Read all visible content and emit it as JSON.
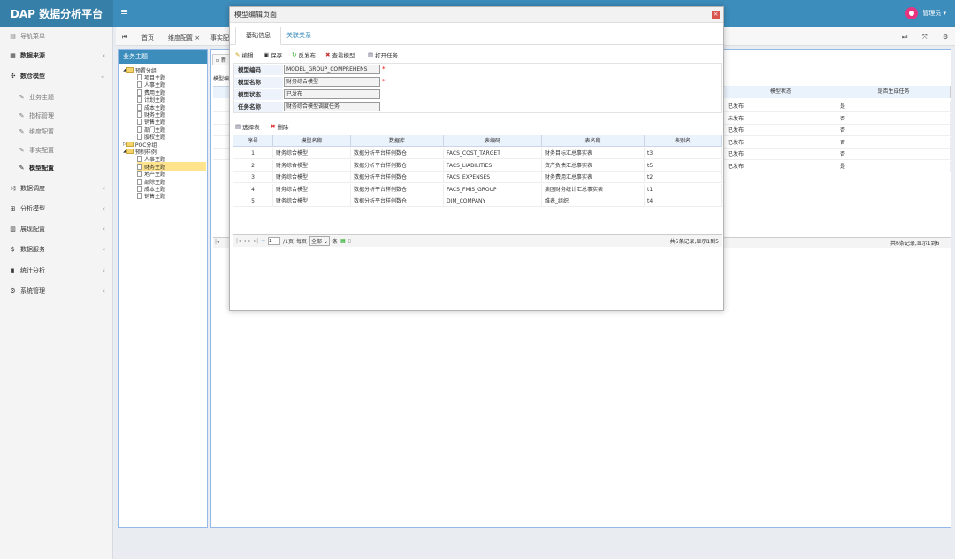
{
  "app": {
    "title": "DAP 数据分析平台",
    "menu_icon": "≡",
    "user": "管理员 ▾"
  },
  "sidebar": {
    "header": "导航菜单",
    "items": [
      {
        "label": "数据来源",
        "icon": "database-icon"
      },
      {
        "label": "数仓模型",
        "icon": "cubes-icon"
      },
      {
        "label": "业务主题",
        "icon": "wrench-icon"
      },
      {
        "label": "指标管理",
        "icon": "wrench-icon"
      },
      {
        "label": "维度配置",
        "icon": "wrench-icon"
      },
      {
        "label": "事实配置",
        "icon": "wrench-icon"
      },
      {
        "label": "模型配置",
        "icon": "wrench-icon"
      },
      {
        "label": "数据调度",
        "icon": "random-icon"
      },
      {
        "label": "分析模型",
        "icon": "sitemap-icon"
      },
      {
        "label": "展现配置",
        "icon": "columns-icon"
      },
      {
        "label": "数据服务",
        "icon": "dollar-icon"
      },
      {
        "label": "统计分析",
        "icon": "chart-icon"
      },
      {
        "label": "系统管理",
        "icon": "gear-icon"
      }
    ]
  },
  "tabs": [
    "首页",
    "维度配置 ×",
    "事实配"
  ],
  "tree": {
    "header": "业务主题",
    "nodes": [
      {
        "label": "预置分组",
        "type": "folder",
        "level": 0
      },
      {
        "label": "项目主题",
        "type": "doc",
        "level": 1
      },
      {
        "label": "人事主题",
        "type": "doc",
        "level": 1
      },
      {
        "label": "费用主题",
        "type": "doc",
        "level": 1
      },
      {
        "label": "计划主题",
        "type": "doc",
        "level": 1
      },
      {
        "label": "成本主题",
        "type": "doc",
        "level": 1
      },
      {
        "label": "财务主题",
        "type": "doc",
        "level": 1
      },
      {
        "label": "销售主题",
        "type": "doc",
        "level": 1
      },
      {
        "label": "部门主题",
        "type": "doc",
        "level": 1
      },
      {
        "label": "股权主题",
        "type": "doc",
        "level": 1
      },
      {
        "label": "POC分组",
        "type": "folder",
        "level": 0
      },
      {
        "label": "预制样例",
        "type": "folder",
        "level": 0
      },
      {
        "label": "人事主题",
        "type": "doc",
        "level": 1
      },
      {
        "label": "财务主题",
        "type": "doc",
        "level": 1,
        "selected": true
      },
      {
        "label": "地产主题",
        "type": "doc",
        "level": 1
      },
      {
        "label": "部除主题",
        "type": "doc",
        "level": 1
      },
      {
        "label": "成本主题",
        "type": "doc",
        "level": 1
      },
      {
        "label": "销售主题",
        "type": "doc",
        "level": 1
      }
    ]
  },
  "bg_grid": {
    "new_btn": "新",
    "partial_label": "模型编",
    "headers": [
      "模型状态",
      "是否生成任务"
    ],
    "rows": [
      [
        "已发布",
        "是"
      ],
      [
        "未发布",
        "否"
      ],
      [
        "已发布",
        "否"
      ],
      [
        "已发布",
        "否"
      ],
      [
        "已发布",
        "否"
      ],
      [
        "已发布",
        "是"
      ]
    ],
    "footer": "共6条记录,显示1到6"
  },
  "dialog": {
    "title": "模型编辑页面",
    "close": "×",
    "tabs": [
      "基础信息",
      "关联关系"
    ],
    "toolbar": [
      "编辑",
      "保存",
      "反发布",
      "查看模型",
      "打开任务"
    ],
    "fields": [
      {
        "label": "模型编码",
        "value": "MODEL_GROUP_COMPREHENS",
        "required": "*"
      },
      {
        "label": "模型名称",
        "value": "财务综合模型",
        "required": "*"
      },
      {
        "label": "模型状态",
        "value": "已发布",
        "required": ""
      },
      {
        "label": "任务名称",
        "value": "财务综合模型调度任务",
        "required": ""
      }
    ],
    "grid_toolbar": [
      "选择表",
      "删除"
    ],
    "headers": [
      "序号",
      "模型名称",
      "数据库",
      "表编码",
      "表名称",
      "表别名"
    ],
    "rows": [
      [
        "1",
        "财务综合模型",
        "数据分析平台样例数仓",
        "FACS_COST_TARGET",
        "财务目标汇总事实表",
        "t3"
      ],
      [
        "2",
        "财务综合模型",
        "数据分析平台样例数仓",
        "FACS_LIABILITIES",
        "资产负债汇总事实表",
        "t5"
      ],
      [
        "3",
        "财务综合模型",
        "数据分析平台样例数仓",
        "FACS_EXPENSES",
        "财务费用汇总事实表",
        "t2"
      ],
      [
        "4",
        "财务综合模型",
        "数据分析平台样例数仓",
        "FACS_FMIS_GROUP",
        "集团财务统计汇总事实表",
        "t1"
      ],
      [
        "5",
        "财务综合模型",
        "数据分析平台样例数仓",
        "DIM_COMPANY",
        "维表_组织",
        "t4"
      ]
    ],
    "pager": {
      "page": "1",
      "total_pages": "/1页",
      "per_page_label": "每页",
      "per_page": "全部",
      "unit": "条",
      "info": "共5条记录,显示1到5"
    }
  }
}
